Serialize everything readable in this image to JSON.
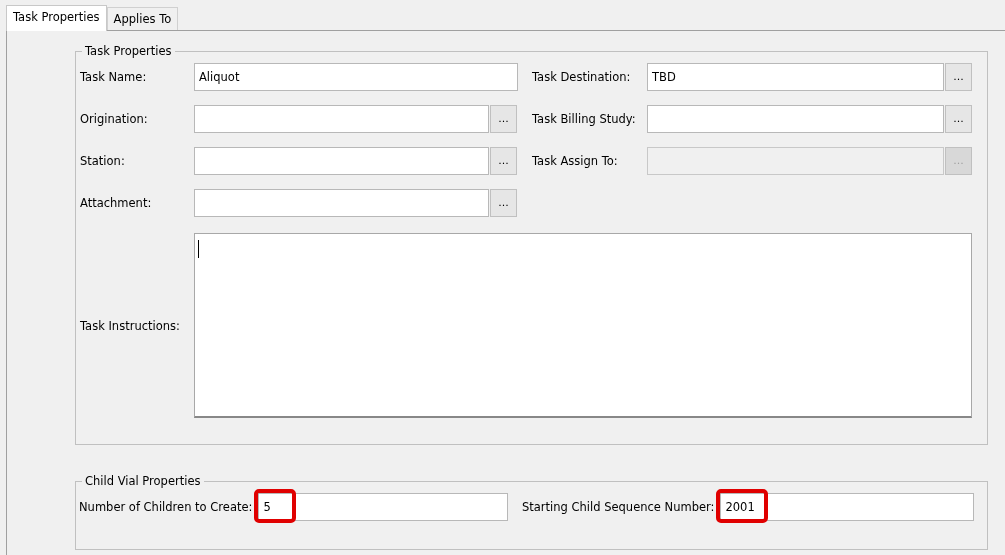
{
  "tabs": [
    {
      "label": "Task Properties",
      "selected": true
    },
    {
      "label": "Applies To",
      "selected": false
    }
  ],
  "task_properties": {
    "title": "Task Properties",
    "rows": [
      [
        {
          "label": "Task Name:",
          "value": "Aliquot",
          "disabled": false
        },
        {
          "label": "Task Destination:",
          "value": "TBD",
          "disabled": false,
          "browse": "..."
        }
      ],
      [
        {
          "label": "Origination:",
          "disabled": false,
          "browse": "..."
        },
        {
          "label": "Task Billing Study:",
          "disabled": false,
          "browse": "..."
        }
      ],
      [
        {
          "label": "Station:",
          "disabled": false,
          "browse": "..."
        },
        {
          "label": "Task Assign To:",
          "disabled": true,
          "browse": "..."
        }
      ],
      [
        {
          "label": "Attachment:",
          "disabled": false,
          "browse": "..."
        }
      ]
    ],
    "instructions": {
      "label": "Task Instructions:",
      "focused": true
    }
  },
  "child_vial_properties": {
    "title": "Child Vial Properties",
    "fields": [
      {
        "label": "Number of Children to Create:",
        "value": "5",
        "highlighted": true
      },
      {
        "label": "Starting Child Sequence Number:",
        "value": "2001",
        "highlighted": true
      }
    ]
  }
}
